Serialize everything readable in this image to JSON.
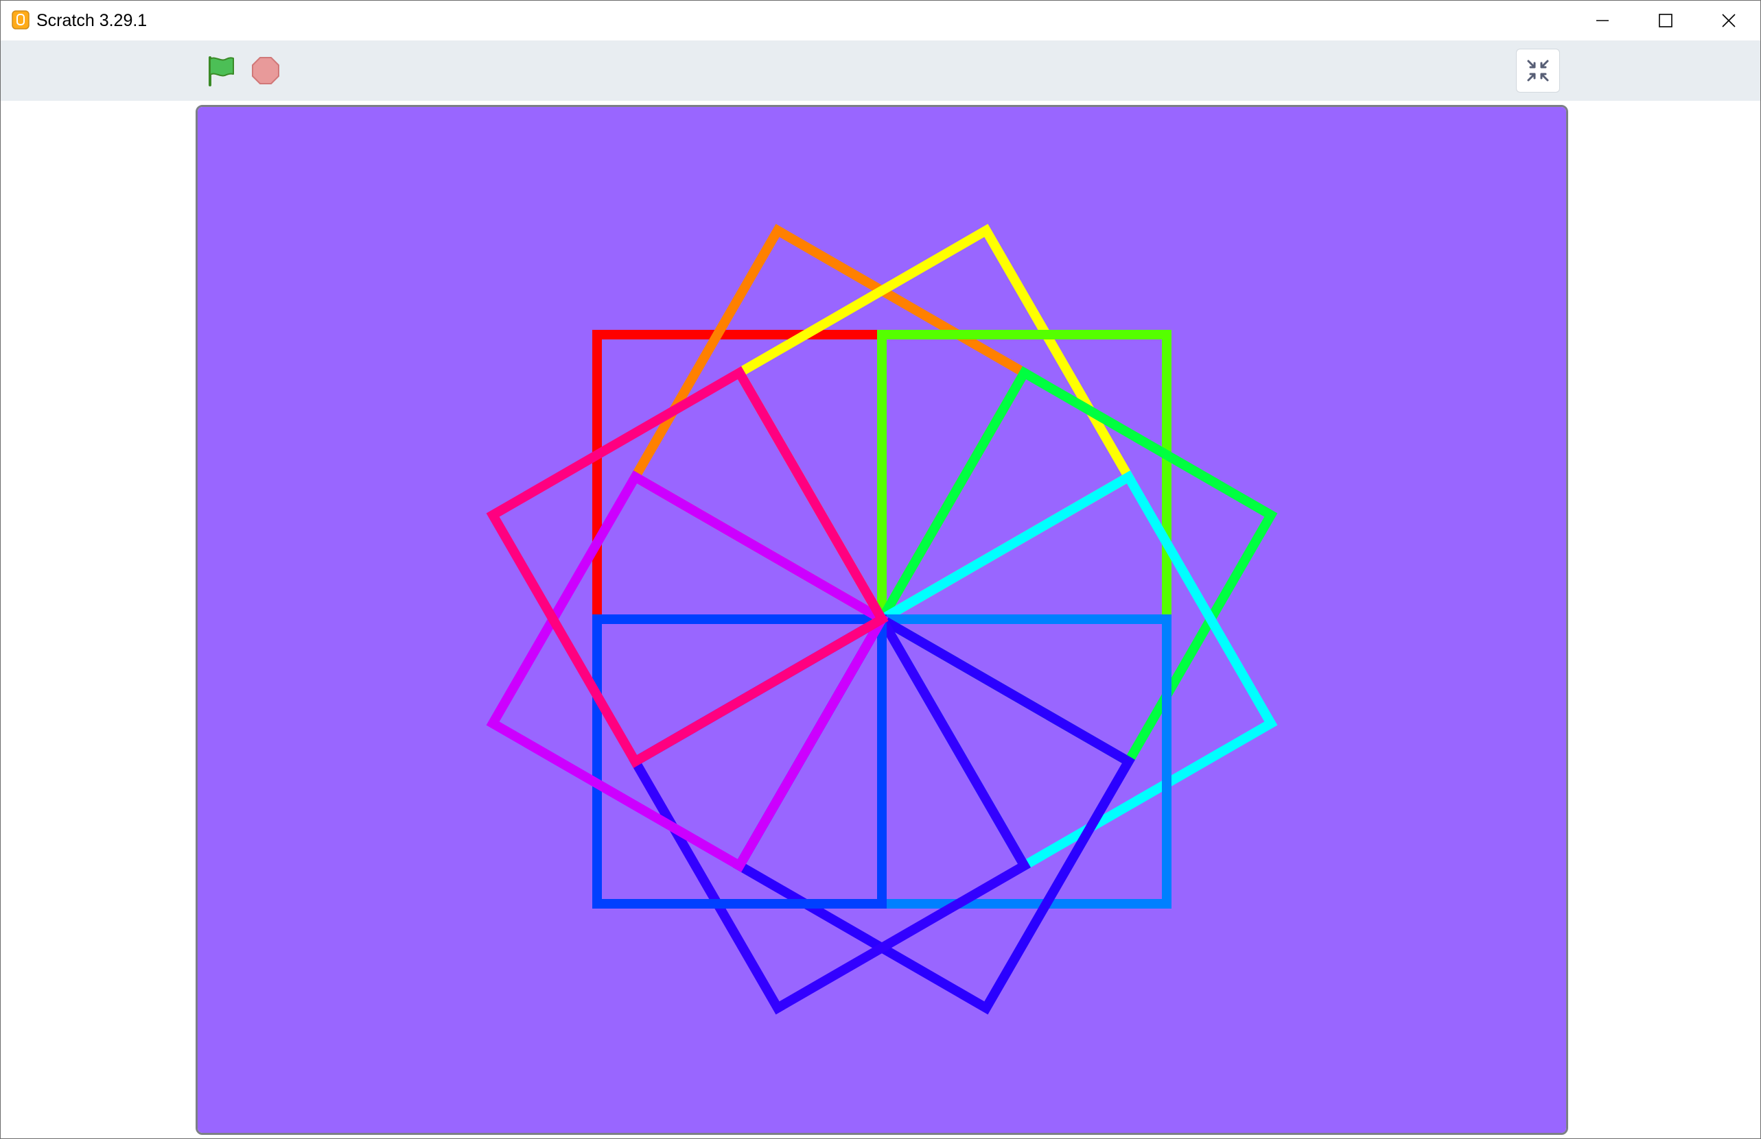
{
  "window": {
    "title": "Scratch 3.29.1",
    "controls": [
      "minimize",
      "maximize",
      "close"
    ]
  },
  "toolbar": {
    "green_flag_icon": "green-flag-icon",
    "stop_icon": "stop-sign-icon",
    "unfullscreen_icon": "unfullscreen-icon"
  },
  "stage": {
    "background_color": "#9966ff",
    "pen_stroke_colors": [
      "#ff0000",
      "#ff8000",
      "#ffff00",
      "#55ff00",
      "#00ff40",
      "#00ffff",
      "#0080ff",
      "#2b00ff",
      "#3300ff",
      "#0040ff",
      "#cc00ff",
      "#ff0080"
    ]
  }
}
